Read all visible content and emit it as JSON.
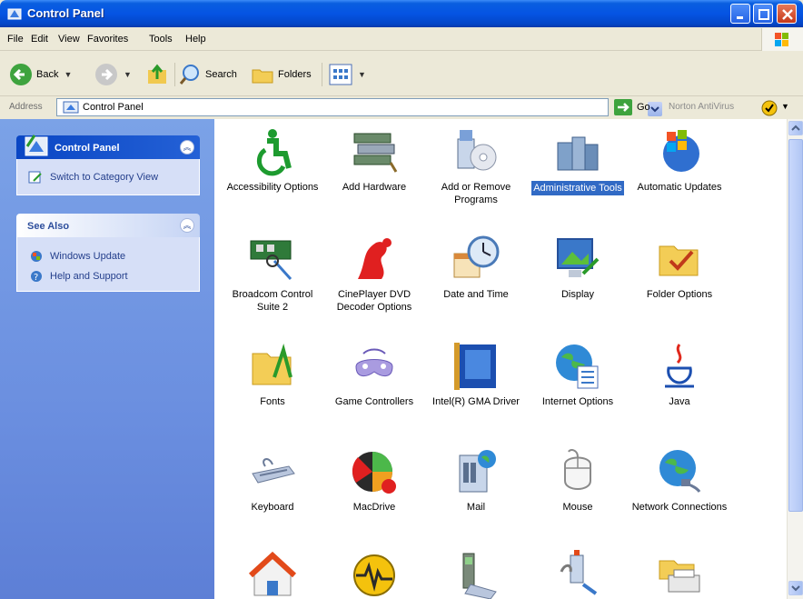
{
  "window": {
    "title": "Control Panel"
  },
  "menu": [
    "File",
    "Edit",
    "View",
    "Favorites",
    "Tools",
    "Help"
  ],
  "toolbar": {
    "back_label": "Back",
    "search_label": "Search",
    "folders_label": "Folders"
  },
  "address": {
    "label": "Address",
    "value": "Control Panel",
    "go_label": "Go",
    "norton_label": "Norton AntiVirus"
  },
  "taskpane": {
    "control_panel_title": "Control Panel",
    "switch_view_label": "Switch to Category View",
    "see_also_title": "See Also",
    "see_also_items": [
      "Windows Update",
      "Help and Support"
    ]
  },
  "items": [
    {
      "label": "Accessibility Options",
      "icon": "accessibility-icon"
    },
    {
      "label": "Add Hardware",
      "icon": "add-hardware-icon"
    },
    {
      "label": "Add or Remove Programs",
      "icon": "add-remove-programs-icon"
    },
    {
      "label": "Administrative Tools",
      "icon": "administrative-tools-icon",
      "selected": true
    },
    {
      "label": "Automatic Updates",
      "icon": "automatic-updates-icon"
    },
    {
      "label": "Broadcom Control Suite 2",
      "icon": "broadcom-icon"
    },
    {
      "label": "CinePlayer DVD Decoder Options",
      "icon": "cineplayer-icon"
    },
    {
      "label": "Date and Time",
      "icon": "date-time-icon"
    },
    {
      "label": "Display",
      "icon": "display-icon"
    },
    {
      "label": "Folder Options",
      "icon": "folder-options-icon"
    },
    {
      "label": "Fonts",
      "icon": "fonts-icon"
    },
    {
      "label": "Game Controllers",
      "icon": "game-controllers-icon"
    },
    {
      "label": "Intel(R) GMA Driver",
      "icon": "intel-gma-icon"
    },
    {
      "label": "Internet Options",
      "icon": "internet-options-icon"
    },
    {
      "label": "Java",
      "icon": "java-icon"
    },
    {
      "label": "Keyboard",
      "icon": "keyboard-icon"
    },
    {
      "label": "MacDrive",
      "icon": "macdrive-icon"
    },
    {
      "label": "Mail",
      "icon": "mail-icon"
    },
    {
      "label": "Mouse",
      "icon": "mouse-icon"
    },
    {
      "label": "Network Connections",
      "icon": "network-connections-icon"
    },
    {
      "label": "",
      "icon": "network-setup-wizard-icon"
    },
    {
      "label": "",
      "icon": "nvidia-icon"
    },
    {
      "label": "",
      "icon": "phone-modem-icon"
    },
    {
      "label": "",
      "icon": "power-options-icon"
    },
    {
      "label": "",
      "icon": "printers-faxes-icon"
    }
  ],
  "colors": {
    "titlebar": "#0554e3",
    "taskpane": "#6b8fe0",
    "selection": "#316ac5"
  }
}
